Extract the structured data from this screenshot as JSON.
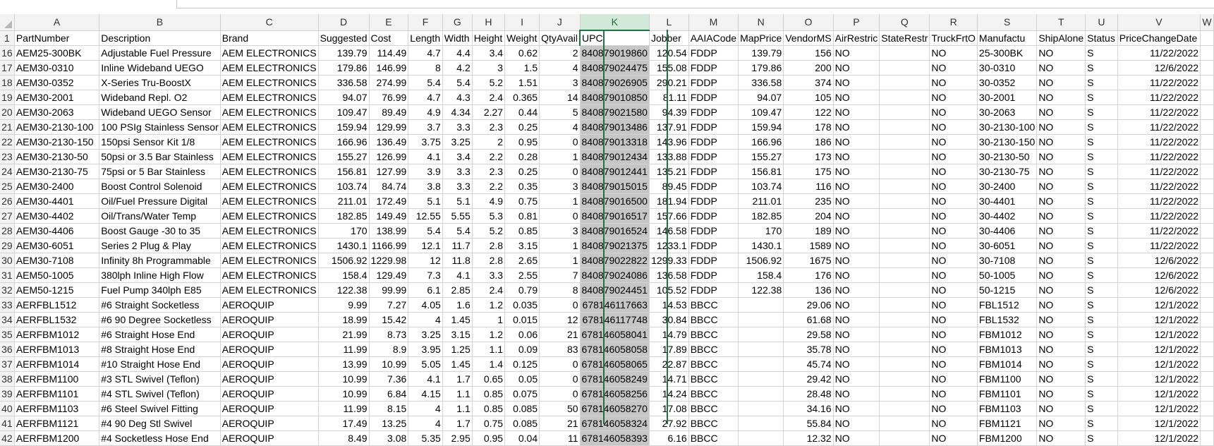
{
  "columns": [
    "A",
    "B",
    "C",
    "D",
    "E",
    "F",
    "G",
    "H",
    "I",
    "J",
    "K",
    "L",
    "M",
    "N",
    "O",
    "P",
    "Q",
    "R",
    "S",
    "T",
    "U",
    "V",
    "W"
  ],
  "selected_column": "K",
  "header_row": {
    "row_number": "1",
    "cells": [
      "PartNumber",
      "Description",
      "Brand",
      "Suggested",
      "Cost",
      "Length",
      "Width",
      "Height",
      "Weight",
      "QtyAvail",
      "UPC",
      "Jobber",
      "AAIACode",
      "MapPrice",
      "VendorMS",
      "AirRestric",
      "StateRestr",
      "TruckFrtO",
      "Manufactu",
      "ShipAlone",
      "Status",
      "PriceChangeDate",
      ""
    ]
  },
  "rows": [
    {
      "n": "16",
      "cells": [
        "AEM25-300BK",
        "Adjustable Fuel Pressure",
        "AEM ELECTRONICS",
        "139.79",
        "114.49",
        "4.7",
        "4.4",
        "3.4",
        "0.62",
        "2",
        "840879019860",
        "120.54",
        "FDDP",
        "139.79",
        "156",
        "NO",
        "",
        "NO",
        "25-300BK",
        "NO",
        "S",
        "11/22/2022",
        ""
      ]
    },
    {
      "n": "17",
      "cells": [
        "AEM30-0310",
        "Inline Wideband UEGO",
        "AEM ELECTRONICS",
        "179.86",
        "146.99",
        "8",
        "4.2",
        "3",
        "1.5",
        "4",
        "840879024475",
        "155.08",
        "FDDP",
        "179.86",
        "200",
        "NO",
        "",
        "NO",
        "30-0310",
        "NO",
        "S",
        "12/6/2022",
        ""
      ]
    },
    {
      "n": "18",
      "cells": [
        "AEM30-0352",
        "X-Series Tru-BoostX",
        "AEM ELECTRONICS",
        "336.58",
        "274.99",
        "5.4",
        "5.4",
        "5.2",
        "1.51",
        "3",
        "840879026905",
        "290.21",
        "FDDP",
        "336.58",
        "374",
        "NO",
        "",
        "NO",
        "30-0352",
        "NO",
        "S",
        "11/22/2022",
        ""
      ]
    },
    {
      "n": "19",
      "cells": [
        "AEM30-2001",
        "Wideband Repl. O2",
        "AEM ELECTRONICS",
        "94.07",
        "76.99",
        "4.7",
        "4.3",
        "2.4",
        "0.365",
        "14",
        "840879010850",
        "81.11",
        "FDDP",
        "94.07",
        "105",
        "NO",
        "",
        "NO",
        "30-2001",
        "NO",
        "S",
        "11/22/2022",
        ""
      ]
    },
    {
      "n": "20",
      "cells": [
        "AEM30-2063",
        "Wideband UEGO Sensor",
        "AEM ELECTRONICS",
        "109.47",
        "89.49",
        "4.9",
        "4.34",
        "2.27",
        "0.44",
        "5",
        "840879021580",
        "94.39",
        "FDDP",
        "109.47",
        "122",
        "NO",
        "",
        "NO",
        "30-2063",
        "NO",
        "S",
        "11/22/2022",
        ""
      ]
    },
    {
      "n": "21",
      "cells": [
        "AEM30-2130-100",
        "100 PSIg Stainless Sensor",
        "AEM ELECTRONICS",
        "159.94",
        "129.99",
        "3.7",
        "3.3",
        "2.3",
        "0.25",
        "4",
        "840879013486",
        "137.91",
        "FDDP",
        "159.94",
        "178",
        "NO",
        "",
        "NO",
        "30-2130-100",
        "NO",
        "S",
        "11/22/2022",
        ""
      ]
    },
    {
      "n": "22",
      "cells": [
        "AEM30-2130-150",
        "150psi Sensor Kit 1/8",
        "AEM ELECTRONICS",
        "166.96",
        "136.49",
        "3.75",
        "3.25",
        "2",
        "0.95",
        "0",
        "840879013318",
        "143.96",
        "FDDP",
        "166.96",
        "186",
        "NO",
        "",
        "NO",
        "30-2130-150",
        "NO",
        "S",
        "11/22/2022",
        ""
      ]
    },
    {
      "n": "23",
      "cells": [
        "AEM30-2130-50",
        "50psi or 3.5 Bar Stainless",
        "AEM ELECTRONICS",
        "155.27",
        "126.99",
        "4.1",
        "3.4",
        "2.2",
        "0.28",
        "1",
        "840879012434",
        "133.88",
        "FDDP",
        "155.27",
        "173",
        "NO",
        "",
        "NO",
        "30-2130-50",
        "NO",
        "S",
        "11/22/2022",
        ""
      ]
    },
    {
      "n": "24",
      "cells": [
        "AEM30-2130-75",
        "75psi or 5 Bar Stainless",
        "AEM ELECTRONICS",
        "156.81",
        "127.99",
        "3.9",
        "3.3",
        "2.3",
        "0.25",
        "0",
        "840879012441",
        "135.21",
        "FDDP",
        "156.81",
        "175",
        "NO",
        "",
        "NO",
        "30-2130-75",
        "NO",
        "S",
        "11/22/2022",
        ""
      ]
    },
    {
      "n": "25",
      "cells": [
        "AEM30-2400",
        "Boost Control Solenoid",
        "AEM ELECTRONICS",
        "103.74",
        "84.74",
        "3.8",
        "3.3",
        "2.2",
        "0.35",
        "3",
        "840879015015",
        "89.45",
        "FDDP",
        "103.74",
        "116",
        "NO",
        "",
        "NO",
        "30-2400",
        "NO",
        "S",
        "11/22/2022",
        ""
      ]
    },
    {
      "n": "26",
      "cells": [
        "AEM30-4401",
        "Oil/Fuel Pressure Digital",
        "AEM ELECTRONICS",
        "211.01",
        "172.49",
        "5.1",
        "5.1",
        "4.9",
        "0.75",
        "1",
        "840879016500",
        "181.94",
        "FDDP",
        "211.01",
        "235",
        "NO",
        "",
        "NO",
        "30-4401",
        "NO",
        "S",
        "11/22/2022",
        ""
      ]
    },
    {
      "n": "27",
      "cells": [
        "AEM30-4402",
        "Oil/Trans/Water Temp",
        "AEM ELECTRONICS",
        "182.85",
        "149.49",
        "12.55",
        "5.55",
        "5.3",
        "0.81",
        "0",
        "840879016517",
        "157.66",
        "FDDP",
        "182.85",
        "204",
        "NO",
        "",
        "NO",
        "30-4402",
        "NO",
        "S",
        "11/22/2022",
        ""
      ]
    },
    {
      "n": "28",
      "cells": [
        "AEM30-4406",
        "Boost Gauge -30 to 35",
        "AEM ELECTRONICS",
        "170",
        "138.99",
        "5.4",
        "5.4",
        "5.2",
        "0.85",
        "3",
        "840879016524",
        "146.58",
        "FDDP",
        "170",
        "189",
        "NO",
        "",
        "NO",
        "30-4406",
        "NO",
        "S",
        "11/22/2022",
        ""
      ]
    },
    {
      "n": "29",
      "cells": [
        "AEM30-6051",
        "Series 2 Plug & Play",
        "AEM ELECTRONICS",
        "1430.1",
        "1166.99",
        "12.1",
        "11.7",
        "2.8",
        "3.15",
        "1",
        "840879021375",
        "1233.1",
        "FDDP",
        "1430.1",
        "1589",
        "NO",
        "",
        "NO",
        "30-6051",
        "NO",
        "S",
        "11/22/2022",
        ""
      ]
    },
    {
      "n": "30",
      "cells": [
        "AEM30-7108",
        "Infinity 8h Programmable",
        "AEM ELECTRONICS",
        "1506.92",
        "1229.98",
        "12",
        "11.8",
        "2.8",
        "2.65",
        "1",
        "840879022822",
        "1299.33",
        "FDDP",
        "1506.92",
        "1675",
        "NO",
        "",
        "NO",
        "30-7108",
        "NO",
        "S",
        "12/6/2022",
        ""
      ]
    },
    {
      "n": "31",
      "cells": [
        "AEM50-1005",
        "380lph Inline High Flow",
        "AEM ELECTRONICS",
        "158.4",
        "129.49",
        "7.3",
        "4.1",
        "3.3",
        "2.55",
        "7",
        "840879024086",
        "136.58",
        "FDDP",
        "158.4",
        "176",
        "NO",
        "",
        "NO",
        "50-1005",
        "NO",
        "S",
        "12/6/2022",
        ""
      ]
    },
    {
      "n": "32",
      "cells": [
        "AEM50-1215",
        "Fuel Pump 340lph E85",
        "AEM ELECTRONICS",
        "122.38",
        "99.99",
        "6.1",
        "2.85",
        "2.4",
        "0.79",
        "8",
        "840879024451",
        "105.52",
        "FDDP",
        "122.38",
        "136",
        "NO",
        "",
        "NO",
        "50-1215",
        "NO",
        "S",
        "12/6/2022",
        ""
      ]
    },
    {
      "n": "33",
      "cells": [
        "AERFBL1512",
        "#6 Straight Socketless",
        "AEROQUIP",
        "9.99",
        "7.27",
        "4.05",
        "1.6",
        "1.2",
        "0.035",
        "0",
        "678146117663",
        "14.53",
        "BBCC",
        "",
        "29.06",
        "NO",
        "",
        "NO",
        "FBL1512",
        "NO",
        "S",
        "12/1/2022",
        ""
      ]
    },
    {
      "n": "34",
      "cells": [
        "AERFBL1532",
        "#6 90 Degree Socketless",
        "AEROQUIP",
        "18.99",
        "15.42",
        "4",
        "1.45",
        "1",
        "0.015",
        "12",
        "678146117748",
        "30.84",
        "BBCC",
        "",
        "61.68",
        "NO",
        "",
        "NO",
        "FBL1532",
        "NO",
        "S",
        "12/1/2022",
        ""
      ]
    },
    {
      "n": "35",
      "cells": [
        "AERFBM1012",
        "#6 Straight Hose End",
        "AEROQUIP",
        "21.99",
        "8.73",
        "3.25",
        "3.15",
        "1.2",
        "0.06",
        "21",
        "678146058041",
        "14.79",
        "BBCC",
        "",
        "29.58",
        "NO",
        "",
        "NO",
        "FBM1012",
        "NO",
        "S",
        "12/1/2022",
        ""
      ]
    },
    {
      "n": "36",
      "cells": [
        "AERFBM1013",
        "#8 Straight Hose End",
        "AEROQUIP",
        "11.99",
        "8.9",
        "3.95",
        "1.25",
        "1.1",
        "0.09",
        "83",
        "678146058058",
        "17.89",
        "BBCC",
        "",
        "35.78",
        "NO",
        "",
        "NO",
        "FBM1013",
        "NO",
        "S",
        "12/1/2022",
        ""
      ]
    },
    {
      "n": "37",
      "cells": [
        "AERFBM1014",
        "#10 Straight Hose End",
        "AEROQUIP",
        "13.99",
        "10.99",
        "5.05",
        "1.45",
        "1.4",
        "0.125",
        "0",
        "678146058065",
        "22.87",
        "BBCC",
        "",
        "45.74",
        "NO",
        "",
        "NO",
        "FBM1014",
        "NO",
        "S",
        "12/1/2022",
        ""
      ]
    },
    {
      "n": "38",
      "cells": [
        "AERFBM1100",
        "#3 STL Swivel (Teflon)",
        "AEROQUIP",
        "10.99",
        "7.36",
        "4.1",
        "1.7",
        "0.65",
        "0.05",
        "0",
        "678146058249",
        "14.71",
        "BBCC",
        "",
        "29.42",
        "NO",
        "",
        "NO",
        "FBM1100",
        "NO",
        "S",
        "12/1/2022",
        ""
      ]
    },
    {
      "n": "39",
      "cells": [
        "AERFBM1101",
        "#4 STL Swivel (Teflon)",
        "AEROQUIP",
        "10.99",
        "6.84",
        "4.15",
        "1.1",
        "0.85",
        "0.075",
        "0",
        "678146058256",
        "14.24",
        "BBCC",
        "",
        "28.48",
        "NO",
        "",
        "NO",
        "FBM1101",
        "NO",
        "S",
        "12/1/2022",
        ""
      ]
    },
    {
      "n": "40",
      "cells": [
        "AERFBM1103",
        "#6 Steel Swivel Fitting",
        "AEROQUIP",
        "11.99",
        "8.15",
        "4",
        "1.1",
        "0.85",
        "0.085",
        "50",
        "678146058270",
        "17.08",
        "BBCC",
        "",
        "34.16",
        "NO",
        "",
        "NO",
        "FBM1103",
        "NO",
        "S",
        "12/1/2022",
        ""
      ]
    },
    {
      "n": "41",
      "cells": [
        "AERFBM1121",
        "#4 90 Deg Stl Swivel",
        "AEROQUIP",
        "17.49",
        "13.25",
        "4",
        "1.7",
        "0.75",
        "0.085",
        "21",
        "678146058324",
        "27.92",
        "BBCC",
        "",
        "55.84",
        "NO",
        "",
        "NO",
        "FBM1121",
        "NO",
        "S",
        "12/1/2022",
        ""
      ]
    },
    {
      "n": "42",
      "cells": [
        "AERFBM1200",
        "#4 Socketless Hose End",
        "AEROQUIP",
        "8.49",
        "3.08",
        "5.35",
        "2.95",
        "0.95",
        "0.04",
        "11",
        "678146058393",
        "6.16",
        "BBCC",
        "",
        "12.32",
        "NO",
        "",
        "NO",
        "FBM1200",
        "NO",
        "S",
        "12/1/2022",
        ""
      ]
    }
  ]
}
